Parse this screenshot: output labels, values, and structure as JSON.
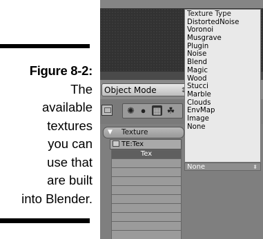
{
  "caption": {
    "figure": "Figure 8-2:",
    "lines": [
      "The",
      "available",
      "textures",
      "you can",
      "use that",
      "are built",
      "into Blender."
    ]
  },
  "toolbar": {
    "mode_label": "Object Mode",
    "mode_arrows": "↕"
  },
  "texture_panel": {
    "tab_label": "Texture",
    "datablock_label": "TE:Tex",
    "list_items": [
      "Tex",
      "",
      "",
      "",
      "",
      "",
      "",
      "",
      "",
      ""
    ]
  },
  "texture_type_menu": {
    "title": "Texture Type",
    "options": [
      "DistortedNoise",
      "Voronoi",
      "Musgrave",
      "Plugin",
      "Noise",
      "Blend",
      "Magic",
      "Wood",
      "Stucci",
      "Marble",
      "Clouds",
      "EnvMap",
      "Image",
      "None"
    ],
    "current_value": "None"
  },
  "colors": {
    "menu_bg": "#e9e9e9",
    "panel_bg": "#7f7f7f",
    "viewport_bg": "#323232"
  }
}
